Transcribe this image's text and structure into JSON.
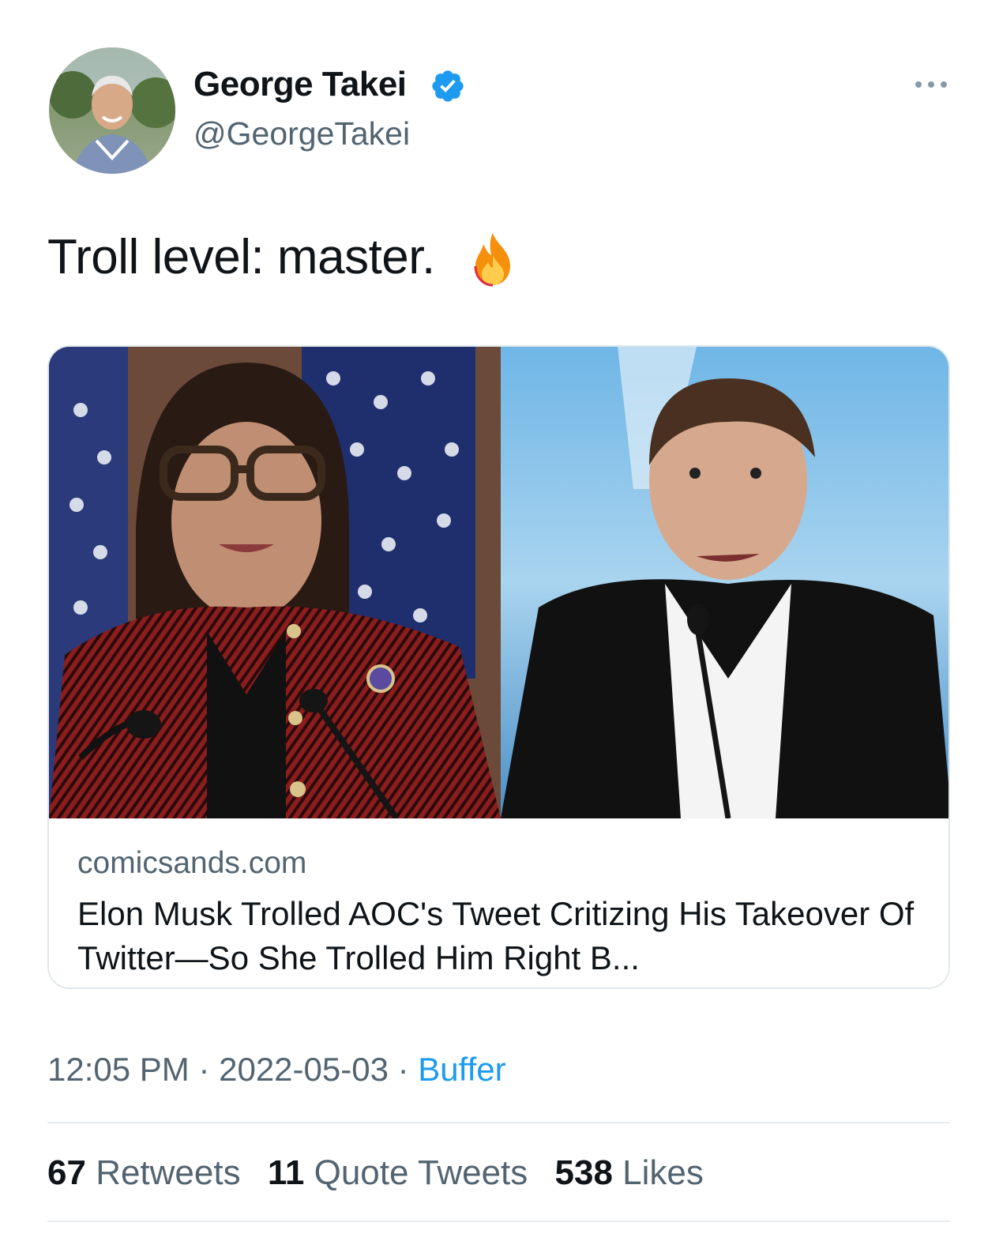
{
  "author": {
    "display_name": "George Takei",
    "handle": "@GeorgeTakei",
    "verified_icon": "verified-badge-icon",
    "avatar": "profile photo"
  },
  "tweet": {
    "text": "Troll level: master.",
    "emoji": "fire-icon"
  },
  "card": {
    "domain": "comicsands.com",
    "title": "Elon Musk Trolled AOC's Tweet Critizing His Takeover Of Twitter—So She Trolled Him Right B..."
  },
  "meta": {
    "time": "12:05 PM",
    "date": "2022-05-03",
    "separator": " · ",
    "source": "Buffer"
  },
  "stats": {
    "retweets_count": "67",
    "retweets_label": "Retweets",
    "quotes_count": "11",
    "quotes_label": "Quote Tweets",
    "likes_count": "538",
    "likes_label": "Likes"
  },
  "colors": {
    "accent": "#1d9bf0",
    "secondary_text": "#536471",
    "primary_text": "#0f1419",
    "border": "#e1e8ed"
  }
}
